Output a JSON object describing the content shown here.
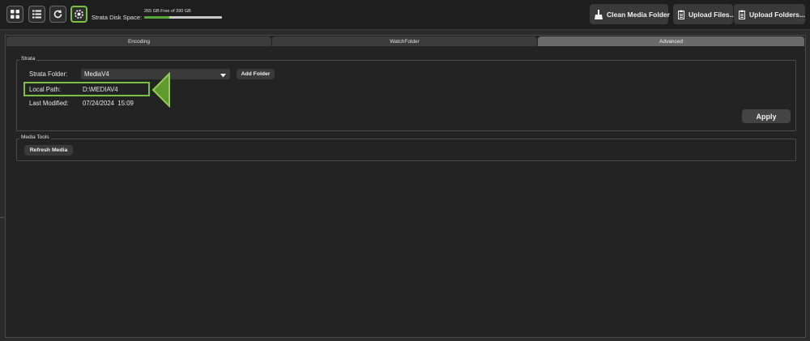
{
  "topbar": {
    "icons": [
      "grid-icon",
      "list-icon",
      "refresh-icon",
      "settings-icon"
    ],
    "disk_label": "Strata Disk Space:",
    "disk_free_text": "265 GB Free of 390 GB",
    "disk_used_fraction": 0.32,
    "buttons": {
      "clean_media": "Clean Media Folder",
      "upload_files": "Upload Files...",
      "upload_folders": "Upload Folders..."
    }
  },
  "tabs": [
    "Encoding",
    "WatchFolder",
    "Advanced"
  ],
  "active_tab": "Advanced",
  "strata": {
    "group_title": "Strata",
    "folder_label": "Strata Folder:",
    "folder_value": "MediaV4",
    "add_folder": "Add Folder",
    "local_path_label": "Local Path:",
    "local_path_value": "D:\\MEDIAV4",
    "last_modified_label": "Last Modified:",
    "last_modified_value": "07/24/2024  15:09",
    "apply": "Apply"
  },
  "media_tools": {
    "group_title": "Media Tools",
    "refresh_media": "Refresh Media"
  },
  "colors": {
    "accent_green": "#7bc043",
    "disk_bar_fill": "#58a63a",
    "background": "#2b2b2b"
  }
}
